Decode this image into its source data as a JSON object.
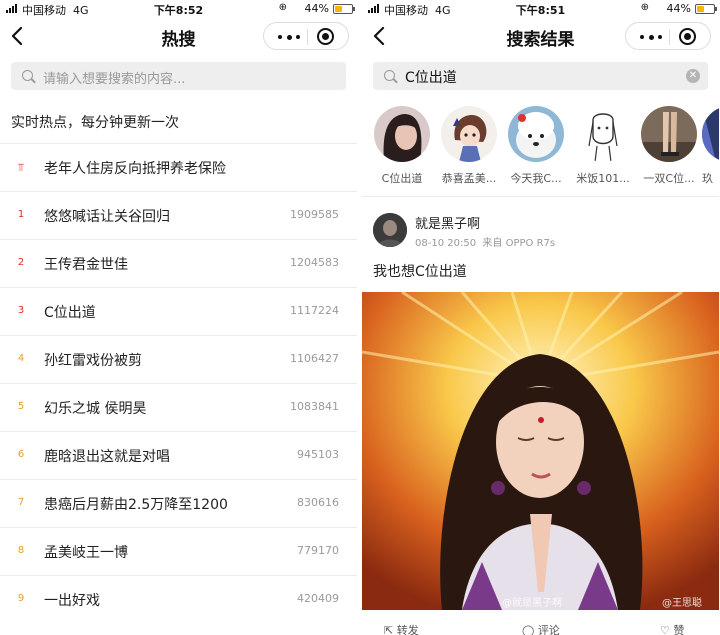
{
  "status_left": {
    "carrier": "中国移动",
    "network": "4G",
    "time": "下午8:52",
    "battery": "44%"
  },
  "status_right": {
    "carrier": "中国移动",
    "network": "4G",
    "time": "下午8:51",
    "battery": "44%"
  },
  "battery_level": 0.44,
  "hot_search": {
    "title": "热搜",
    "search_placeholder": "请输入想要搜索的内容...",
    "header": "实时热点，每分钟更新一次",
    "items": [
      {
        "rank": "",
        "topic": "老年人住房反向抵押养老保险",
        "count": ""
      },
      {
        "rank": "1",
        "topic": "悠悠喊话让关谷回归",
        "count": "1909585"
      },
      {
        "rank": "2",
        "topic": "王传君金世佳",
        "count": "1204583"
      },
      {
        "rank": "3",
        "topic": "C位出道",
        "count": "1117224"
      },
      {
        "rank": "4",
        "topic": "孙红雷戏份被剪",
        "count": "1106427"
      },
      {
        "rank": "5",
        "topic": "幻乐之城 侯明昊",
        "count": "1083841"
      },
      {
        "rank": "6",
        "topic": "鹿晗退出这就是对唱",
        "count": "945103"
      },
      {
        "rank": "7",
        "topic": "患癌后月薪由2.5万降至1200",
        "count": "830616"
      },
      {
        "rank": "8",
        "topic": "孟美岐王一博",
        "count": "779170"
      },
      {
        "rank": "9",
        "topic": "一出好戏",
        "count": "420409"
      }
    ],
    "rank_colors": [
      "#e0301e",
      "#e0301e",
      "#e0301e",
      "#e0301e",
      "#f09a2a",
      "#f09a2a",
      "#f09a2a",
      "#f09a2a",
      "#f09a2a",
      "#f09a2a"
    ]
  },
  "search_results": {
    "title": "搜索结果",
    "query": "C位出道",
    "clear_icon": "clear-icon",
    "users": [
      {
        "name": "C位出道"
      },
      {
        "name": "恭喜孟美..."
      },
      {
        "name": "今天我C..."
      },
      {
        "name": "米饭101..."
      },
      {
        "name": "一双C位..."
      },
      {
        "name": "玖"
      }
    ],
    "post": {
      "user": "就是黑子啊",
      "time": "08-10 20:50",
      "source": "来自 OPPO R7s",
      "text": "我也想C位出道",
      "watermark_left": "@就是黑子啊",
      "watermark_right": "@王思聪"
    },
    "actions": [
      {
        "label": "转发",
        "icon": "repost-icon"
      },
      {
        "label": "评论",
        "icon": "comment-icon"
      },
      {
        "label": "赞",
        "icon": "like-icon"
      }
    ]
  }
}
